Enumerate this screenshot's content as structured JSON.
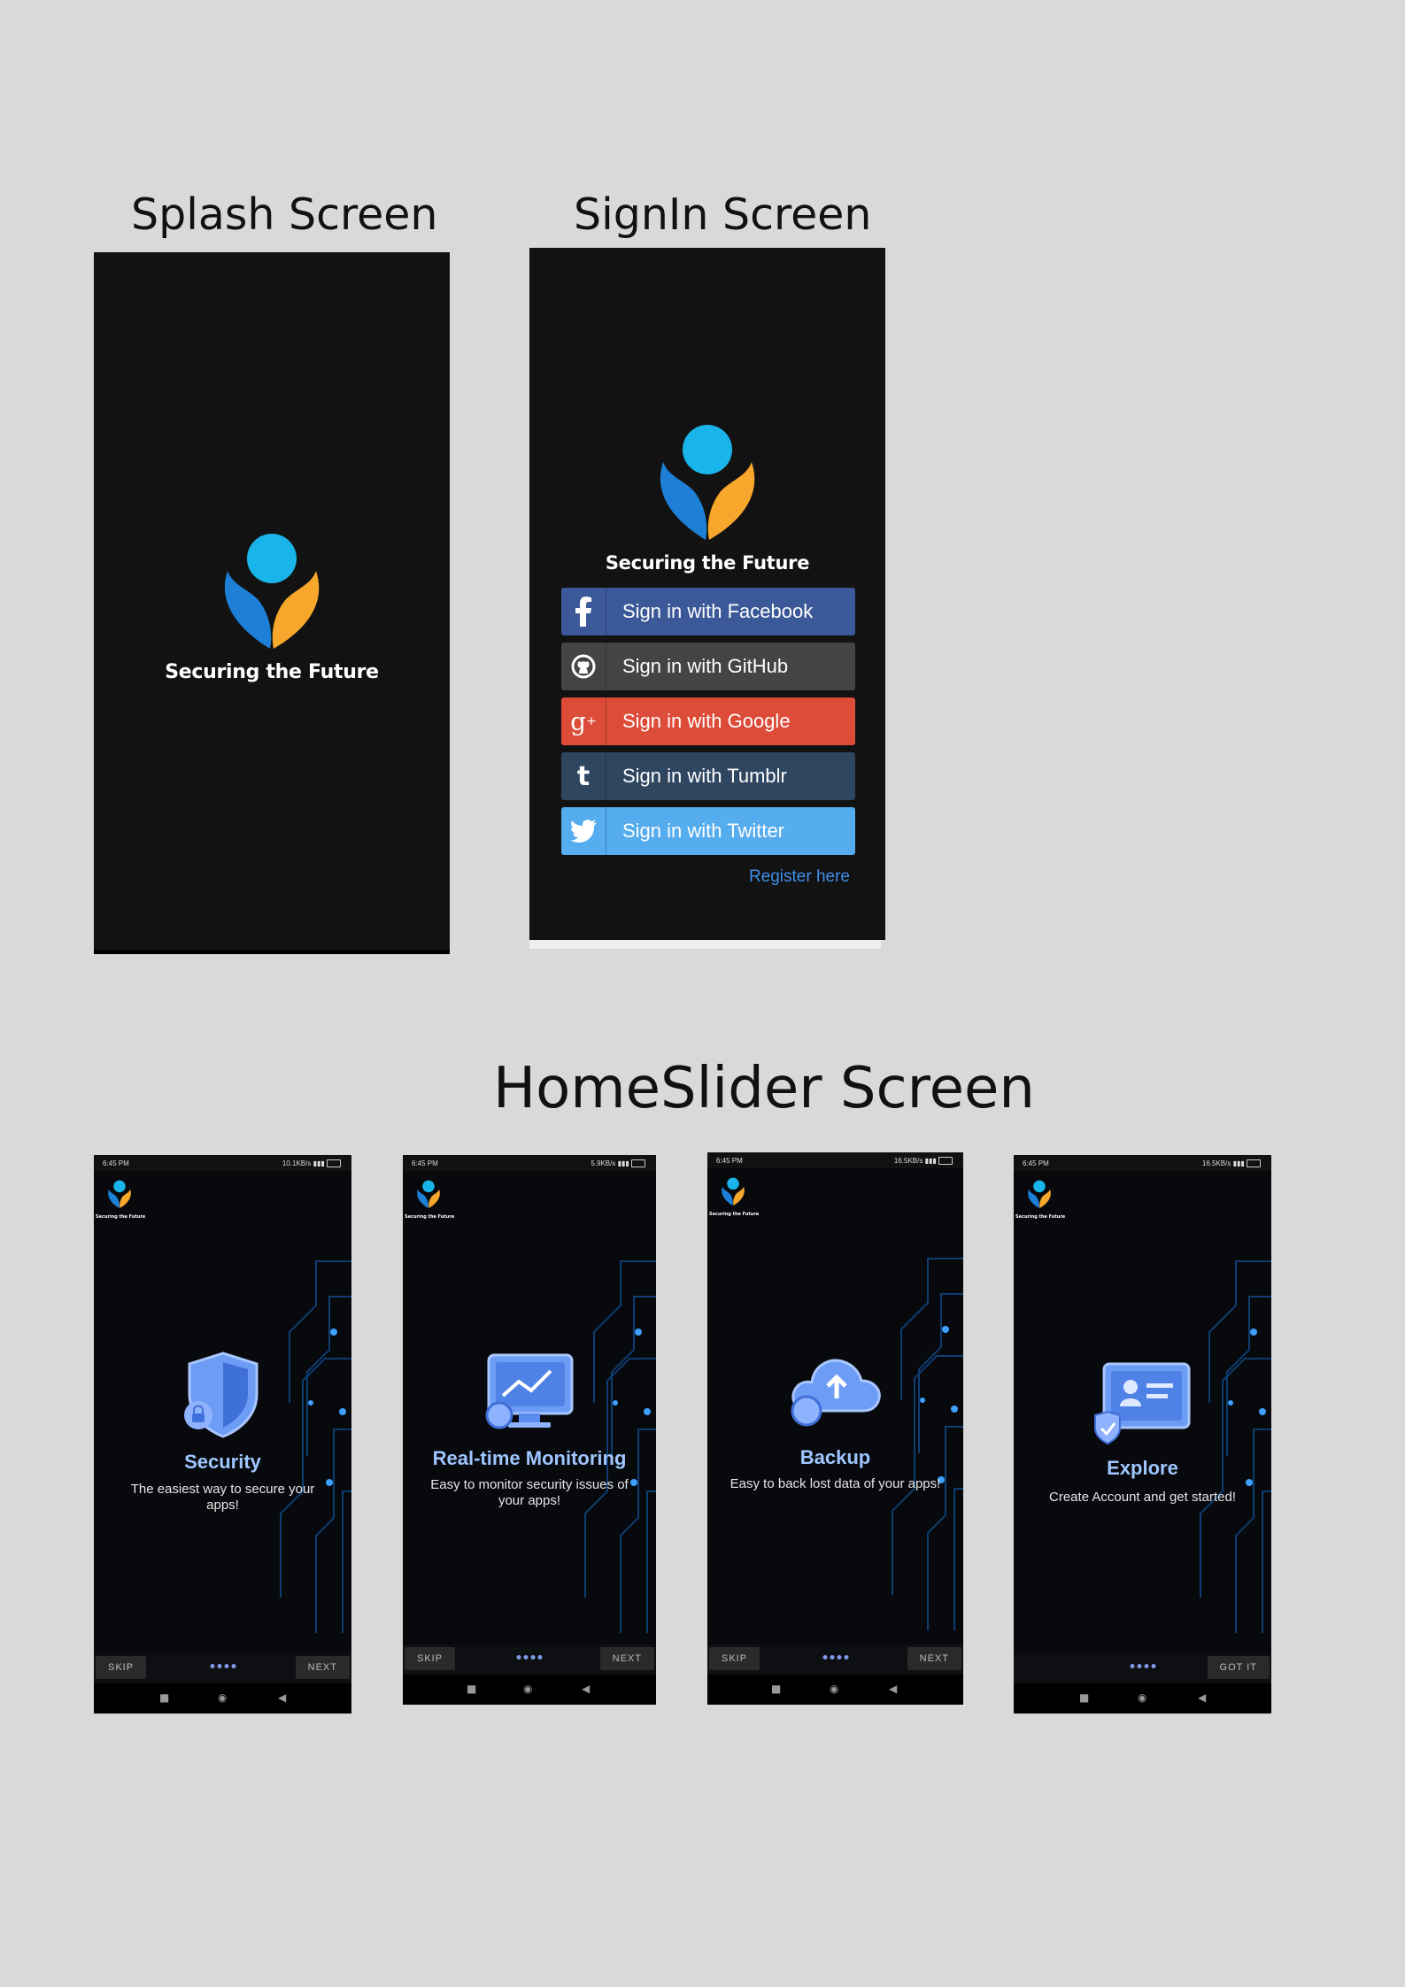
{
  "sections": {
    "splash_title": "Splash Screen",
    "signin_title": "SignIn Screen",
    "homeslider_title": "HomeSlider Screen"
  },
  "brand": {
    "logo_text": "Securing the Future",
    "colors": {
      "blue": "#1e7fd6",
      "cyan": "#19b5ea",
      "orange": "#f7a72b",
      "phone_bg": "#121212"
    }
  },
  "signin": {
    "buttons": [
      {
        "label": "Sign in with Facebook",
        "icon": "facebook-icon",
        "color": "#3b5998"
      },
      {
        "label": "Sign in with GitHub",
        "icon": "github-icon",
        "color": "#444444"
      },
      {
        "label": "Sign in with Google",
        "icon": "google-plus-icon",
        "color": "#dd4b39"
      },
      {
        "label": "Sign in with Tumblr",
        "icon": "tumblr-icon",
        "color": "#2f4661"
      },
      {
        "label": "Sign in with Twitter",
        "icon": "twitter-icon",
        "color": "#55acee"
      }
    ],
    "register_link": "Register here"
  },
  "slides": [
    {
      "status_time": "6:45 PM",
      "status_net": "10.1KB/s",
      "icon": "shield-lock-icon",
      "title": "Security",
      "description": "The easiest way to secure your apps!",
      "skip_label": "SKIP",
      "next_label": "NEXT"
    },
    {
      "status_time": "6:45 PM",
      "status_net": "5.9KB/s",
      "icon": "monitor-chart-icon",
      "title": "Real-time Monitoring",
      "description": "Easy to monitor security issues of your apps!",
      "skip_label": "SKIP",
      "next_label": "NEXT"
    },
    {
      "status_time": "6:45 PM",
      "status_net": "16.5KB/s",
      "icon": "cloud-upload-icon",
      "title": "Backup",
      "description": "Easy to back lost data of your apps!",
      "skip_label": "SKIP",
      "next_label": "NEXT"
    },
    {
      "status_time": "6:45 PM",
      "status_net": "16.5KB/s",
      "icon": "id-card-shield-icon",
      "title": "Explore",
      "description": "Create Account and get started!",
      "next_label": "GOT IT"
    }
  ]
}
